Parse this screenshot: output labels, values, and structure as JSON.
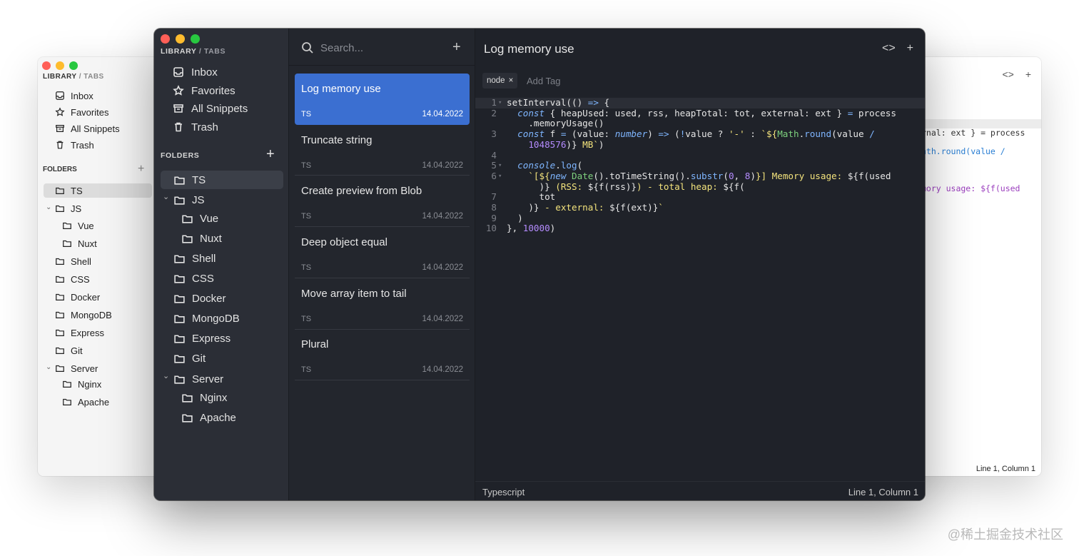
{
  "colors": {
    "accent": "#3b6fd1",
    "dark_bg": "#1f2229",
    "sidebar_bg": "#2b2e36",
    "list_bg": "#23262d",
    "light_bg": "#f5f5f5"
  },
  "light_window": {
    "breadcrumb": {
      "library": "LIBRARY",
      "sep": "/",
      "tabs": "TABS"
    },
    "nav": [
      {
        "label": "Inbox",
        "icon": "inbox-icon"
      },
      {
        "label": "Favorites",
        "icon": "star-icon"
      },
      {
        "label": "All Snippets",
        "icon": "archive-icon"
      },
      {
        "label": "Trash",
        "icon": "trash-icon"
      }
    ],
    "folders_header": "FOLDERS",
    "folders": [
      "TS",
      "JS",
      "Vue",
      "Nuxt",
      "Shell",
      "CSS",
      "Docker",
      "MongoDB",
      "Express",
      "Git",
      "Server",
      "Nginx",
      "Apache"
    ],
    "code_fragments": [
      "rnal: ext } = process",
      "ath.round(value /",
      "mory usage: ${f(used"
    ],
    "status": "Line 1, Column 1"
  },
  "sidebar": {
    "breadcrumb": {
      "library": "LIBRARY",
      "sep": "/",
      "tabs": "TABS"
    },
    "nav": [
      {
        "label": "Inbox",
        "icon": "inbox-icon"
      },
      {
        "label": "Favorites",
        "icon": "star-icon"
      },
      {
        "label": "All Snippets",
        "icon": "archive-icon"
      },
      {
        "label": "Trash",
        "icon": "trash-icon"
      }
    ],
    "folders_header": "FOLDERS",
    "folders": [
      {
        "label": "TS",
        "selected": true
      },
      {
        "label": "JS",
        "expanded": true
      },
      {
        "label": "Vue"
      },
      {
        "label": "Nuxt"
      },
      {
        "label": "Shell"
      },
      {
        "label": "CSS"
      },
      {
        "label": "Docker"
      },
      {
        "label": "MongoDB"
      },
      {
        "label": "Express"
      },
      {
        "label": "Git"
      },
      {
        "label": "Server",
        "expanded": true
      },
      {
        "label": "Nginx"
      },
      {
        "label": "Apache"
      }
    ]
  },
  "snippet_list": {
    "search_placeholder": "Search...",
    "items": [
      {
        "title": "Log memory use",
        "lang": "TS",
        "date": "14.04.2022",
        "active": true
      },
      {
        "title": "Truncate string",
        "lang": "TS",
        "date": "14.04.2022"
      },
      {
        "title": "Create preview from Blob",
        "lang": "TS",
        "date": "14.04.2022"
      },
      {
        "title": "Deep object equal",
        "lang": "TS",
        "date": "14.04.2022"
      },
      {
        "title": "Move array item to tail",
        "lang": "TS",
        "date": "14.04.2022"
      },
      {
        "title": "Plural",
        "lang": "TS",
        "date": "14.04.2022"
      }
    ]
  },
  "editor": {
    "title": "Log memory use",
    "tag": "node",
    "tag_remove": "×",
    "add_tag_placeholder": "Add Tag",
    "language": "Typescript",
    "cursor": "Line 1, Column 1",
    "line_numbers": [
      "1",
      "2",
      "",
      "3",
      "",
      "4",
      "5",
      "6",
      "",
      "7",
      "8",
      "9",
      "10"
    ]
  },
  "watermark": "@稀土掘金技术社区"
}
